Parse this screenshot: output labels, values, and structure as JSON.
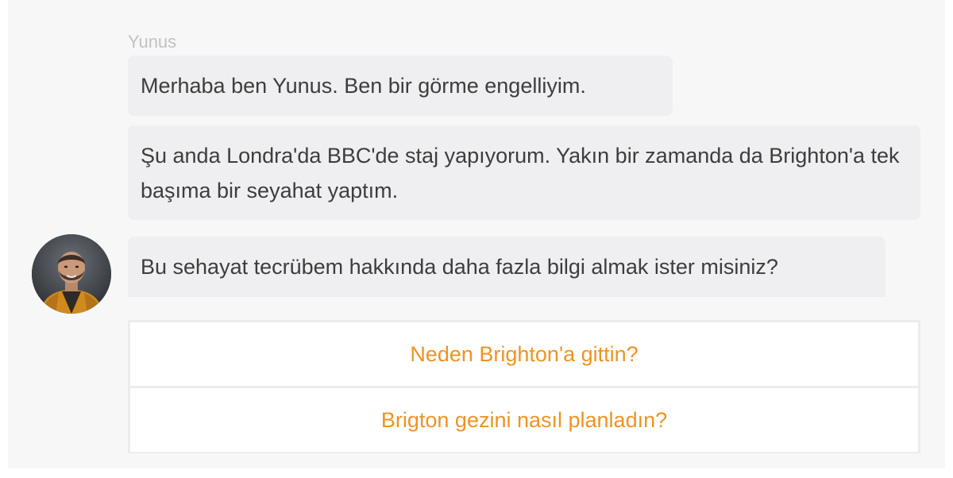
{
  "chat": {
    "sender_name": "Yunus",
    "messages": [
      {
        "text": "Merhaba ben Yunus. Ben bir görme engelliyim."
      },
      {
        "text": "Şu anda Londra'da BBC'de staj yapıyorum. Yakın bir zamanda da Brighton'a tek başıma bir seyahat yaptım."
      },
      {
        "text": "Bu sehayat tecrübem hakkında daha fazla bilgi almak ister misiniz?"
      }
    ],
    "avatar": {
      "icon": "user-avatar-photo"
    },
    "quick_replies": [
      {
        "label": "Neden Brighton'a gittin?"
      },
      {
        "label": "Brigton gezini nasıl planladın?"
      }
    ]
  },
  "colors": {
    "background": "#f7f7f7",
    "bubble": "#efeff1",
    "message_text": "#3d3d3d",
    "sender_name": "#c2c2c2",
    "reply_accent": "#ef9322"
  }
}
